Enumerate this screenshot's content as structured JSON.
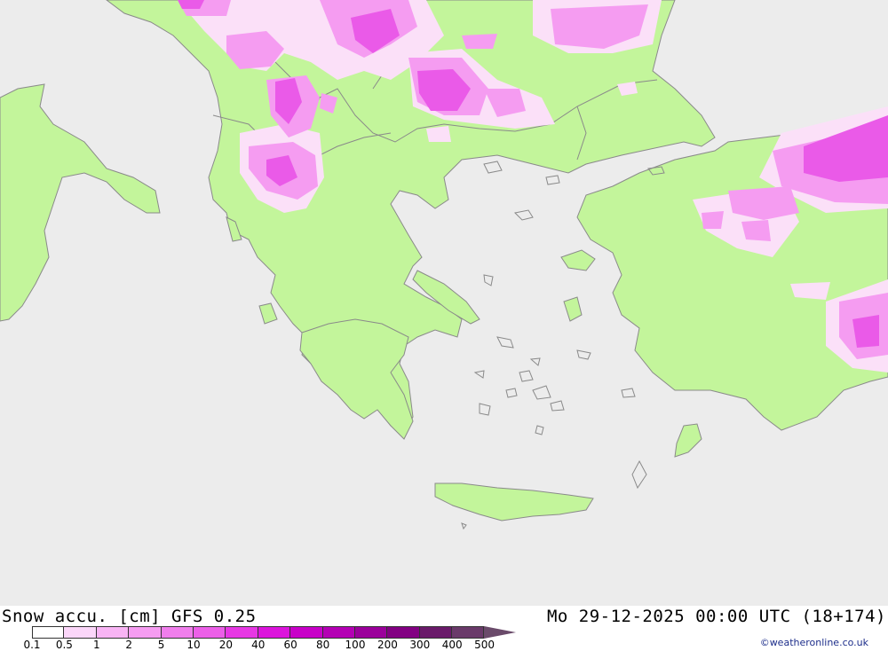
{
  "header": {
    "title_left": "Snow accu. [cm] GFS 0.25",
    "title_right": "Mo 29-12-2025 00:00 UTC (18+174)"
  },
  "legend": {
    "labels": [
      "0.1",
      "0.5",
      "1",
      "2",
      "5",
      "10",
      "20",
      "40",
      "60",
      "80",
      "100",
      "200",
      "300",
      "400",
      "500"
    ],
    "colors": [
      "#ffffff",
      "#fbd6f9",
      "#f8b4f4",
      "#f59cf1",
      "#f07eec",
      "#ec5fe8",
      "#e738e4",
      "#dc14dc",
      "#c800c8",
      "#b400b4",
      "#9b009b",
      "#820082",
      "#6a1a6a",
      "#6a3a6a"
    ]
  },
  "map": {
    "colors": {
      "sea": "#ececec",
      "land": "#ececec",
      "snow_green": "#c3f59b",
      "snow_light": "#fbe0f8",
      "snow_pink": "#f59cf1",
      "snow_magenta": "#ea5ae8",
      "border": "#8a8a8a"
    }
  },
  "credit": "©weatheronline.co.uk"
}
